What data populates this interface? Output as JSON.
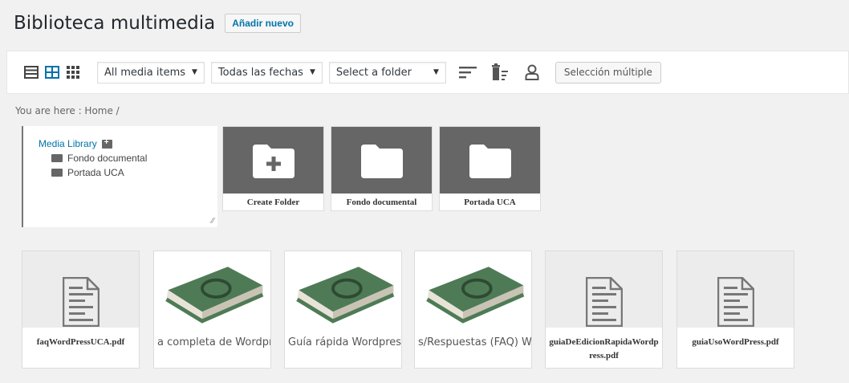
{
  "header": {
    "title": "Biblioteca multimedia",
    "add_new": "Añadir nuevo"
  },
  "toolbar": {
    "view_icons": [
      "list-view-icon",
      "grid-view-icon",
      "small-grid-view-icon"
    ],
    "media_filter": "All media items",
    "date_filter": "Todas las fechas",
    "folder_filter": "Select a folder",
    "multi_select": "Selección múltiple"
  },
  "breadcrumb": "You are here : Home /",
  "tree": {
    "root": "Media Library",
    "items": [
      "Fondo documental",
      "Portada UCA"
    ]
  },
  "folders": [
    {
      "label": "Create Folder",
      "icon": "folder-plus-icon"
    },
    {
      "label": "Fondo documental",
      "icon": "folder-icon"
    },
    {
      "label": "Portada UCA",
      "icon": "folder-icon"
    }
  ],
  "media": [
    {
      "label": "faqWordPressUCA.pdf",
      "type": "document"
    },
    {
      "label": "a completa de Wordpr",
      "type": "book"
    },
    {
      "label": "Guía rápida Wordpres",
      "type": "book"
    },
    {
      "label": "s/Respuestas (FAQ) W",
      "type": "book"
    },
    {
      "label": "guiaDeEdicionRapidaWordpress.pdf",
      "type": "document"
    },
    {
      "label": "guiaUsoWordPress.pdf",
      "type": "document"
    }
  ],
  "colors": {
    "accent": "#0073aa",
    "folder_gray": "#666666",
    "book_green": "#4e7b55"
  }
}
